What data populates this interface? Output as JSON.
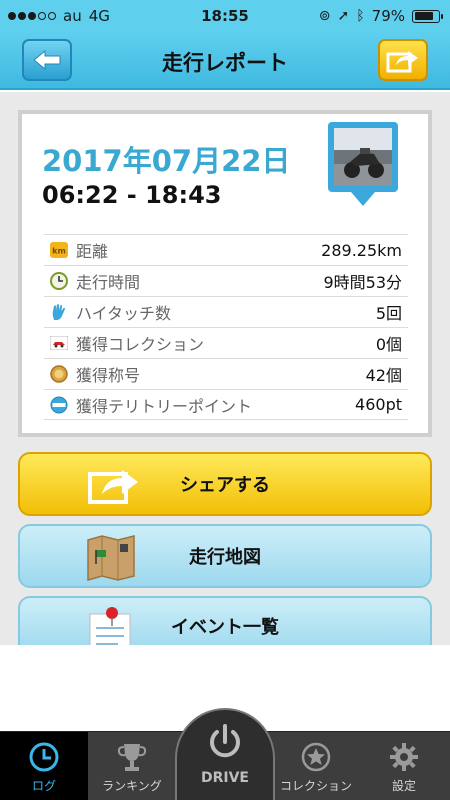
{
  "status": {
    "carrier": "au",
    "network": "4G",
    "time": "18:55",
    "battery": "79%",
    "battery_fraction": 0.79
  },
  "nav": {
    "title": "走行レポート",
    "back_icon": "back-arrow-icon",
    "share_icon": "share-icon"
  },
  "report": {
    "date": "2017年07月22日",
    "time_range": "06:22 - 18:43",
    "photo_icon": "motorcycle-photo",
    "stats": [
      {
        "label": "距離",
        "value": "289.25km",
        "icon": "km-icon"
      },
      {
        "label": "走行時間",
        "value": "9時間53分",
        "icon": "clock-icon"
      },
      {
        "label": "ハイタッチ数",
        "value": "5回",
        "icon": "hand-icon"
      },
      {
        "label": "獲得コレクション",
        "value": "0個",
        "icon": "car-card-icon"
      },
      {
        "label": "獲得称号",
        "value": "42個",
        "icon": "medal-icon"
      },
      {
        "label": "獲得テリトリーポイント",
        "value": "460pt",
        "icon": "spot-icon"
      }
    ]
  },
  "buttons": {
    "share": "シェアする",
    "map": "走行地図",
    "events": "イベント一覧"
  },
  "tabs": {
    "log": "ログ",
    "ranking": "ランキング",
    "drive": "DRIVE",
    "collection": "コレクション",
    "settings": "設定"
  },
  "colors": {
    "accent": "#3fb9e0",
    "date": "#39a9d1",
    "share_button": "#f2bf06",
    "active_tab": "#3bb7ea"
  }
}
